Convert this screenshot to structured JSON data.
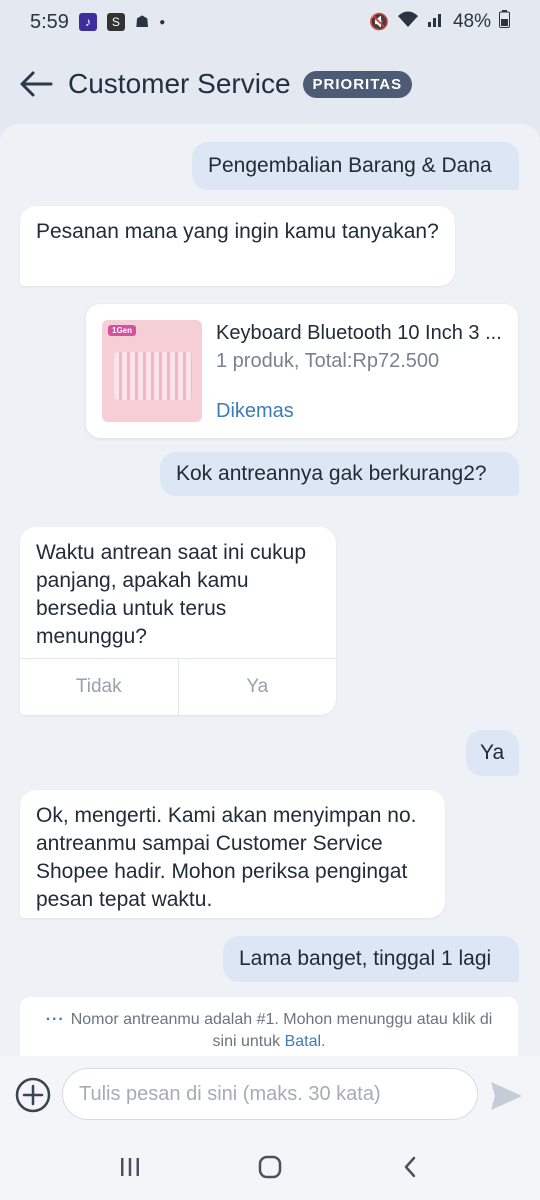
{
  "status_bar": {
    "time": "5:59",
    "battery": "48%",
    "icons": [
      "app-notification-icon",
      "shopee-icon",
      "android-icon",
      "dot-icon",
      "mute-icon",
      "wifi-icon",
      "signal-icon",
      "battery-icon"
    ]
  },
  "header": {
    "title": "Customer Service",
    "badge": "PRIORITAS"
  },
  "messages": [
    {
      "side": "out",
      "text": "Pengembalian Barang & Dana"
    },
    {
      "side": "in",
      "text": "Pesanan mana yang ingin kamu tanyakan?"
    },
    {
      "side": "out",
      "text": "Kok antreannya gak berkurang2?"
    },
    {
      "side": "out",
      "text": "Ya"
    },
    {
      "side": "in",
      "text": "Ok, mengerti. Kami akan menyimpan no. antreanmu sampai Customer Service Shopee hadir. Mohon periksa pengingat pesan tepat waktu."
    },
    {
      "side": "out",
      "text": "Lama banget, tinggal 1 lagi"
    }
  ],
  "order_card": {
    "product_name": "Keyboard Bluetooth 10 Inch 3 ...",
    "summary": "1 produk, Total:Rp72.500",
    "status": "Dikemas",
    "thumb_tag": "1Gen"
  },
  "question_card": {
    "text": "Waktu antrean saat ini cukup panjang, apakah kamu bersedia untuk terus menunggu?",
    "options": [
      "Tidak",
      "Ya"
    ]
  },
  "queue_notice": {
    "text": "Nomor antreanmu adalah #1. Mohon menunggu atau klik di sini untuk ",
    "link": "Batal",
    "end": "."
  },
  "composer": {
    "placeholder": "Tulis pesan di sini (maks. 30 kata)"
  },
  "colors": {
    "accent": "#3e7bb8",
    "badge_bg": "#4d5b74",
    "outgoing_bubble": "#dde6f4"
  }
}
